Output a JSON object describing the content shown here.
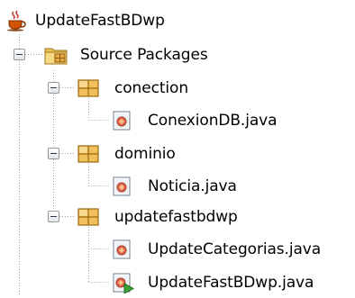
{
  "tree": {
    "project": {
      "label": "UpdateFastBDwp",
      "icon": "java-project-cup-icon"
    },
    "source_packages": {
      "label": "Source Packages",
      "icon": "source-packages-folder-icon",
      "expanded": true
    },
    "packages": [
      {
        "label": "conection",
        "icon": "package-icon",
        "expanded": true,
        "files": [
          {
            "label": "ConexionDB.java",
            "icon": "java-class-icon",
            "main": false
          }
        ]
      },
      {
        "label": "dominio",
        "icon": "package-icon",
        "expanded": true,
        "files": [
          {
            "label": "Noticia.java",
            "icon": "java-class-icon",
            "main": false
          }
        ]
      },
      {
        "label": "updatefastbdwp",
        "icon": "package-icon",
        "expanded": true,
        "files": [
          {
            "label": "UpdateCategorias.java",
            "icon": "java-class-icon",
            "main": false
          },
          {
            "label": "UpdateFastBDwp.java",
            "icon": "java-main-class-icon",
            "main": true
          }
        ]
      }
    ]
  },
  "colors": {
    "guide_line": "#a0a0a0",
    "toggle_border": "#919b9c",
    "folder": "#e8b548",
    "package": "#e9a945",
    "java_class": "#d9534f",
    "main_arrow": "#3aa53a"
  }
}
